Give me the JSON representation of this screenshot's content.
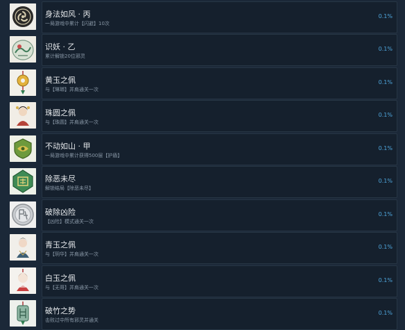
{
  "achievements": [
    {
      "icon": "triskelion-icon",
      "title": "身法如风 · 丙",
      "desc": "一局游戏中累计【闪避】10次",
      "pct": "0.1%"
    },
    {
      "icon": "demon-scroll-icon",
      "title": "识妖 · 乙",
      "desc": "累计解锁20位邪灵",
      "pct": "0.1%"
    },
    {
      "icon": "yellow-jade-pendant-icon",
      "title": "黄玉之佩",
      "desc": "与【琳瑯】并肩通关一次",
      "pct": "0.1%"
    },
    {
      "icon": "pearl-pendant-portrait-icon",
      "title": "珠圆之佩",
      "desc": "与【珠圆】并肩通关一次",
      "pct": "0.1%"
    },
    {
      "icon": "green-shield-icon",
      "title": "不动如山 · 甲",
      "desc": "一局游戏中累计获得500层【护盾】",
      "pct": "0.1%"
    },
    {
      "icon": "evil-removal-seal-icon",
      "title": "除恶未尽",
      "desc": "解锁结局【除恶未尽】",
      "pct": "0.1%"
    },
    {
      "icon": "silver-danger-seal-icon",
      "title": "破除凶险",
      "desc": "【凶险】模式通关一次",
      "pct": "0.1%"
    },
    {
      "icon": "cyan-jade-pendant-icon",
      "title": "青玉之佩",
      "desc": "与【玥华】并肩通关一次",
      "pct": "0.1%"
    },
    {
      "icon": "white-jade-pendant-icon",
      "title": "白玉之佩",
      "desc": "与【无哥】并肩通关一次",
      "pct": "0.1%"
    },
    {
      "icon": "bamboo-jade-pendant-icon",
      "title": "破竹之势",
      "desc": "击败过中所有邪灵并通关",
      "pct": "0.1%"
    }
  ]
}
